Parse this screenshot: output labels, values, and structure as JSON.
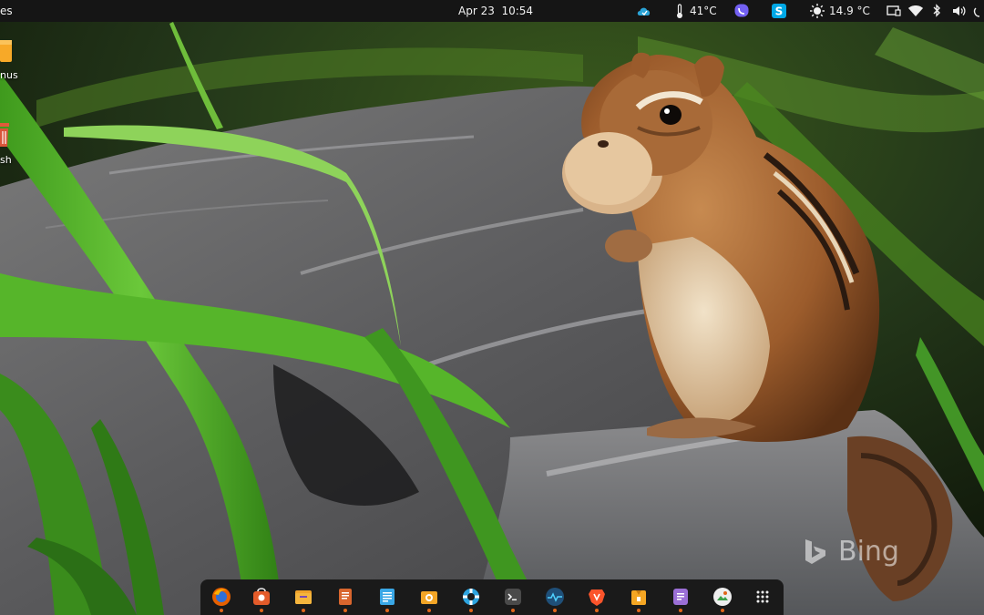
{
  "topbar": {
    "activities_label": "es",
    "date": "Apr 23",
    "time": "10:54",
    "cpu_temp": "41°C",
    "weather_temp": "14.9 °C",
    "tray_icons": [
      "cloud-sync-icon",
      "thermometer-icon",
      "viber-icon",
      "skype-icon",
      "weather-sun-icon",
      "screen-icon",
      "wifi-icon",
      "bluetooth-icon",
      "volume-icon"
    ]
  },
  "desktop": {
    "icons": [
      {
        "label": "nus",
        "icon": "folder-icon"
      },
      {
        "label": "sh",
        "icon": "trash-icon"
      }
    ]
  },
  "watermark": {
    "text": "Bing"
  },
  "dock": {
    "apps": [
      {
        "icon": "firefox-icon",
        "running": true
      },
      {
        "icon": "software-center-icon",
        "running": true
      },
      {
        "icon": "files-icon",
        "running": true
      },
      {
        "icon": "document-viewer-icon",
        "running": true
      },
      {
        "icon": "text-editor-icon",
        "running": true
      },
      {
        "icon": "screenshot-icon",
        "running": true
      },
      {
        "icon": "help-lifebuoy-icon",
        "running": true
      },
      {
        "icon": "terminal-icon",
        "running": true
      },
      {
        "icon": "system-monitor-icon",
        "running": true
      },
      {
        "icon": "brave-browser-icon",
        "running": true
      },
      {
        "icon": "archive-manager-icon",
        "running": true
      },
      {
        "icon": "notes-icon",
        "running": true
      },
      {
        "icon": "image-viewer-icon",
        "running": true
      },
      {
        "icon": "app-grid-icon",
        "running": false
      }
    ]
  },
  "colors": {
    "topbar_bg": "#151515",
    "dock_bg": "#1a1a1a",
    "running_indicator": "#e0661a"
  }
}
